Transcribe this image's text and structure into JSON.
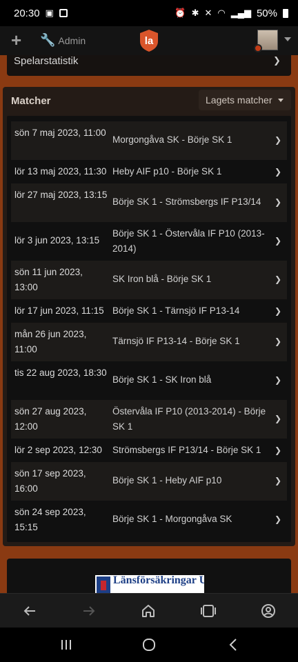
{
  "status_bar": {
    "time": "20:30",
    "battery": "50%"
  },
  "header": {
    "admin_label": "Admin",
    "logo_text": "la"
  },
  "sections": {
    "player_stats_title": "Spelarstatistik"
  },
  "matches": {
    "title": "Matcher",
    "dropdown_label": "Lagets matcher",
    "rows": [
      {
        "date": "sön 7 maj 2023, 11:00",
        "match": "Morgongåva SK - Börje SK 1"
      },
      {
        "date": "lör 13 maj 2023, 11:30",
        "match": "Heby AIF p10 - Börje SK 1"
      },
      {
        "date": "lör 27 maj 2023, 13:15",
        "match": "Börje SK 1 - Strömsbergs IF P13/14"
      },
      {
        "date": "lör 3 jun 2023, 13:15",
        "match": "Börje SK 1 - Östervåla IF P10 (2013-2014)"
      },
      {
        "date": "sön 11 jun 2023, 13:00",
        "match": "SK Iron blå - Börje SK 1"
      },
      {
        "date": "lör 17 jun 2023, 11:15",
        "match": "Börje SK 1 - Tärnsjö IF P13-14"
      },
      {
        "date": "mån 26 jun 2023, 11:00",
        "match": "Tärnsjö IF P13-14 - Börje SK 1"
      },
      {
        "date": "tis 22 aug 2023, 18:30",
        "match": "Börje SK 1 - SK Iron blå"
      },
      {
        "date": "sön 27 aug 2023, 12:00",
        "match": "Östervåla IF P10 (2013-2014) - Börje SK 1"
      },
      {
        "date": "lör 2 sep 2023, 12:30",
        "match": "Strömsbergs IF P13/14 - Börje SK 1"
      },
      {
        "date": "sön 17 sep 2023, 16:00",
        "match": "Börje SK 1 - Heby AIF p10"
      },
      {
        "date": "sön 24 sep 2023, 15:15",
        "match": "Börje SK 1 - Morgongåva SK"
      }
    ]
  },
  "promo": {
    "text": "Länsförsäkringar Uppsala"
  },
  "colors": {
    "accent": "#8a3a12",
    "brand_logo": "#d9552b"
  },
  "icons": {
    "add": "plus-icon",
    "admin": "wrench-icon",
    "back": "arrow-left-icon",
    "forward": "arrow-right-icon",
    "home": "home-icon",
    "tabs": "tabs-icon",
    "account": "account-icon"
  }
}
